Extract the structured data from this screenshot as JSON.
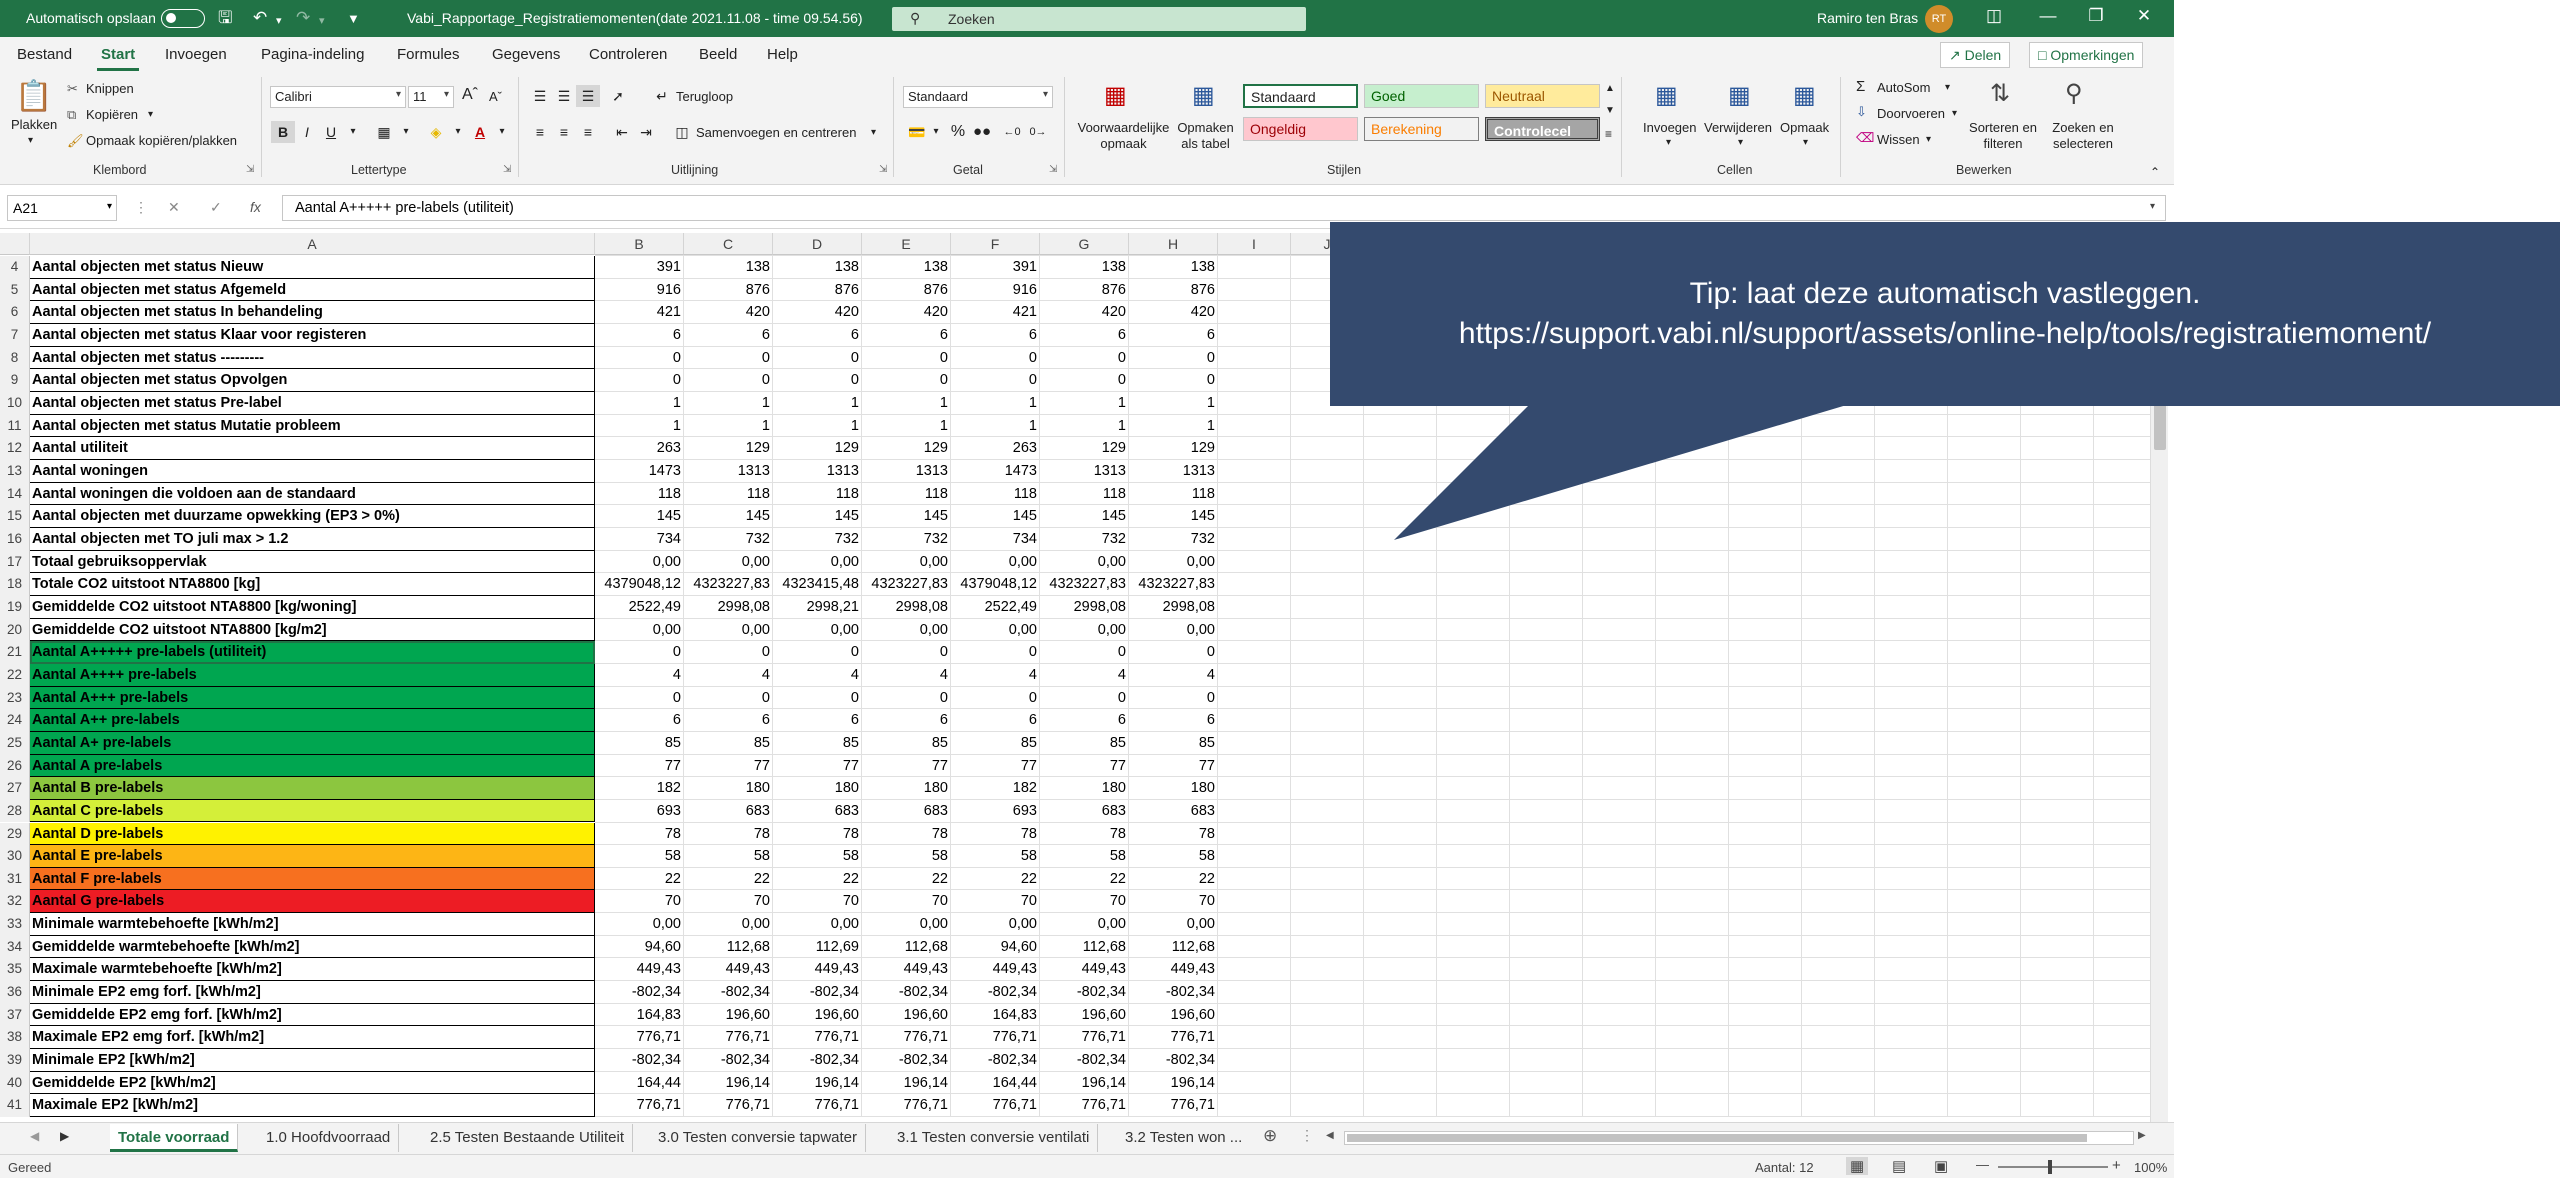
{
  "titlebar": {
    "autosave_label": "Automatisch opslaan",
    "file_title": "Vabi_Rapportage_Registratiemomenten(date 2021.11.08 - time 09.54.56)",
    "search_placeholder": "Zoeken",
    "user_name": "Ramiro ten Bras",
    "user_initials": "RT"
  },
  "menu": {
    "items": [
      "Bestand",
      "Start",
      "Invoegen",
      "Pagina-indeling",
      "Formules",
      "Gegevens",
      "Controleren",
      "Beeld",
      "Help"
    ],
    "active": "Start",
    "share_label": "Delen",
    "comments_label": "Opmerkingen"
  },
  "ribbon": {
    "klembord": {
      "plakken": "Plakken",
      "knippen": "Knippen",
      "kopieren": "Kopiëren",
      "opmaak_kopieren": "Opmaak kopiëren/plakken",
      "group": "Klembord"
    },
    "lettertype": {
      "font": "Calibri",
      "size": "11",
      "group": "Lettertype"
    },
    "uitlijning": {
      "terugloop": "Terugloop",
      "samenvoegen": "Samenvoegen en centreren",
      "group": "Uitlijning"
    },
    "getal": {
      "format": "Standaard",
      "group": "Getal"
    },
    "stijlen": {
      "voorwaardelijk": "Voorwaardelijke opmaak",
      "opmaken_tabel": "Opmaken als tabel",
      "styles": [
        "Standaard",
        "Goed",
        "Neutraal",
        "Ongeldig",
        "Berekening",
        "Controlecel"
      ],
      "group": "Stijlen"
    },
    "cellen": {
      "invoegen": "Invoegen",
      "verwijderen": "Verwijderen",
      "opmaak": "Opmaak",
      "group": "Cellen"
    },
    "bewerken": {
      "autosom": "AutoSom",
      "doorvoeren": "Doorvoeren",
      "wissen": "Wissen",
      "sorteren": "Sorteren en filteren",
      "zoeken": "Zoeken en selecteren",
      "group": "Bewerken"
    }
  },
  "formula_bar": {
    "name_box": "A21",
    "formula": "Aantal A+++++ pre-labels (utiliteit)"
  },
  "grid": {
    "columns": [
      "A",
      "B",
      "C",
      "D",
      "E",
      "F",
      "G",
      "H",
      "I",
      "J"
    ],
    "rows": [
      {
        "n": "4",
        "label": "Aantal objecten met status Nieuw",
        "v": [
          "391",
          "138",
          "138",
          "138",
          "391",
          "138",
          "138"
        ],
        "fill": ""
      },
      {
        "n": "5",
        "label": "Aantal objecten met status Afgemeld",
        "v": [
          "916",
          "876",
          "876",
          "876",
          "916",
          "876",
          "876"
        ],
        "fill": ""
      },
      {
        "n": "6",
        "label": "Aantal objecten met status In behandeling",
        "v": [
          "421",
          "420",
          "420",
          "420",
          "421",
          "420",
          "420"
        ],
        "fill": ""
      },
      {
        "n": "7",
        "label": "Aantal objecten met status Klaar voor registeren",
        "v": [
          "6",
          "6",
          "6",
          "6",
          "6",
          "6",
          "6"
        ],
        "fill": ""
      },
      {
        "n": "8",
        "label": "Aantal objecten met status ---------",
        "v": [
          "0",
          "0",
          "0",
          "0",
          "0",
          "0",
          "0"
        ],
        "fill": ""
      },
      {
        "n": "9",
        "label": "Aantal objecten met status Opvolgen",
        "v": [
          "0",
          "0",
          "0",
          "0",
          "0",
          "0",
          "0"
        ],
        "fill": ""
      },
      {
        "n": "10",
        "label": "Aantal objecten met status Pre-label",
        "v": [
          "1",
          "1",
          "1",
          "1",
          "1",
          "1",
          "1"
        ],
        "fill": ""
      },
      {
        "n": "11",
        "label": "Aantal objecten met status Mutatie probleem",
        "v": [
          "1",
          "1",
          "1",
          "1",
          "1",
          "1",
          "1"
        ],
        "fill": ""
      },
      {
        "n": "12",
        "label": "Aantal utiliteit",
        "v": [
          "263",
          "129",
          "129",
          "129",
          "263",
          "129",
          "129"
        ],
        "fill": ""
      },
      {
        "n": "13",
        "label": "Aantal woningen",
        "v": [
          "1473",
          "1313",
          "1313",
          "1313",
          "1473",
          "1313",
          "1313"
        ],
        "fill": ""
      },
      {
        "n": "14",
        "label": "Aantal woningen die voldoen aan de standaard",
        "v": [
          "118",
          "118",
          "118",
          "118",
          "118",
          "118",
          "118"
        ],
        "fill": ""
      },
      {
        "n": "15",
        "label": "Aantal objecten met duurzame opwekking (EP3 > 0%)",
        "v": [
          "145",
          "145",
          "145",
          "145",
          "145",
          "145",
          "145"
        ],
        "fill": ""
      },
      {
        "n": "16",
        "label": "Aantal objecten met TO juli max > 1.2",
        "v": [
          "734",
          "732",
          "732",
          "732",
          "734",
          "732",
          "732"
        ],
        "fill": ""
      },
      {
        "n": "17",
        "label": "Totaal gebruiksoppervlak",
        "v": [
          "0,00",
          "0,00",
          "0,00",
          "0,00",
          "0,00",
          "0,00",
          "0,00"
        ],
        "fill": ""
      },
      {
        "n": "18",
        "label": "Totale CO2 uitstoot NTA8800 [kg]",
        "v": [
          "4379048,12",
          "4323227,83",
          "4323415,48",
          "4323227,83",
          "4379048,12",
          "4323227,83",
          "4323227,83"
        ],
        "fill": ""
      },
      {
        "n": "19",
        "label": "Gemiddelde CO2 uitstoot NTA8800 [kg/woning]",
        "v": [
          "2522,49",
          "2998,08",
          "2998,21",
          "2998,08",
          "2522,49",
          "2998,08",
          "2998,08"
        ],
        "fill": ""
      },
      {
        "n": "20",
        "label": "Gemiddelde CO2 uitstoot NTA8800 [kg/m2]",
        "v": [
          "0,00",
          "0,00",
          "0,00",
          "0,00",
          "0,00",
          "0,00",
          "0,00"
        ],
        "fill": ""
      },
      {
        "n": "21",
        "label": "Aantal A+++++ pre-labels (utiliteit)",
        "v": [
          "0",
          "0",
          "0",
          "0",
          "0",
          "0",
          "0"
        ],
        "fill": "#00a650"
      },
      {
        "n": "22",
        "label": "Aantal A++++ pre-labels",
        "v": [
          "4",
          "4",
          "4",
          "4",
          "4",
          "4",
          "4"
        ],
        "fill": "#00a650"
      },
      {
        "n": "23",
        "label": "Aantal A+++ pre-labels",
        "v": [
          "0",
          "0",
          "0",
          "0",
          "0",
          "0",
          "0"
        ],
        "fill": "#00a650"
      },
      {
        "n": "24",
        "label": "Aantal A++ pre-labels",
        "v": [
          "6",
          "6",
          "6",
          "6",
          "6",
          "6",
          "6"
        ],
        "fill": "#00a650"
      },
      {
        "n": "25",
        "label": "Aantal A+ pre-labels",
        "v": [
          "85",
          "85",
          "85",
          "85",
          "85",
          "85",
          "85"
        ],
        "fill": "#00a650"
      },
      {
        "n": "26",
        "label": "Aantal A pre-labels",
        "v": [
          "77",
          "77",
          "77",
          "77",
          "77",
          "77",
          "77"
        ],
        "fill": "#00a650"
      },
      {
        "n": "27",
        "label": "Aantal B pre-labels",
        "v": [
          "182",
          "180",
          "180",
          "180",
          "182",
          "180",
          "180"
        ],
        "fill": "#8cc63f"
      },
      {
        "n": "28",
        "label": "Aantal C pre-labels",
        "v": [
          "693",
          "683",
          "683",
          "683",
          "693",
          "683",
          "683"
        ],
        "fill": "#d4ef39"
      },
      {
        "n": "29",
        "label": "Aantal D pre-labels",
        "v": [
          "78",
          "78",
          "78",
          "78",
          "78",
          "78",
          "78"
        ],
        "fill": "#fff200"
      },
      {
        "n": "30",
        "label": "Aantal E pre-labels",
        "v": [
          "58",
          "58",
          "58",
          "58",
          "58",
          "58",
          "58"
        ],
        "fill": "#fdb515"
      },
      {
        "n": "31",
        "label": "Aantal F pre-labels",
        "v": [
          "22",
          "22",
          "22",
          "22",
          "22",
          "22",
          "22"
        ],
        "fill": "#f7701f"
      },
      {
        "n": "32",
        "label": "Aantal G pre-labels",
        "v": [
          "70",
          "70",
          "70",
          "70",
          "70",
          "70",
          "70"
        ],
        "fill": "#ed1c24"
      },
      {
        "n": "33",
        "label": "Minimale warmtebehoefte [kWh/m2]",
        "v": [
          "0,00",
          "0,00",
          "0,00",
          "0,00",
          "0,00",
          "0,00",
          "0,00"
        ],
        "fill": ""
      },
      {
        "n": "34",
        "label": "Gemiddelde warmtebehoefte [kWh/m2]",
        "v": [
          "94,60",
          "112,68",
          "112,69",
          "112,68",
          "94,60",
          "112,68",
          "112,68"
        ],
        "fill": ""
      },
      {
        "n": "35",
        "label": "Maximale warmtebehoefte [kWh/m2]",
        "v": [
          "449,43",
          "449,43",
          "449,43",
          "449,43",
          "449,43",
          "449,43",
          "449,43"
        ],
        "fill": ""
      },
      {
        "n": "36",
        "label": "Minimale EP2 emg forf. [kWh/m2]",
        "v": [
          "-802,34",
          "-802,34",
          "-802,34",
          "-802,34",
          "-802,34",
          "-802,34",
          "-802,34"
        ],
        "fill": ""
      },
      {
        "n": "37",
        "label": "Gemiddelde EP2 emg forf. [kWh/m2]",
        "v": [
          "164,83",
          "196,60",
          "196,60",
          "196,60",
          "164,83",
          "196,60",
          "196,60"
        ],
        "fill": ""
      },
      {
        "n": "38",
        "label": "Maximale EP2 emg forf. [kWh/m2]",
        "v": [
          "776,71",
          "776,71",
          "776,71",
          "776,71",
          "776,71",
          "776,71",
          "776,71"
        ],
        "fill": ""
      },
      {
        "n": "39",
        "label": "Minimale EP2 [kWh/m2]",
        "v": [
          "-802,34",
          "-802,34",
          "-802,34",
          "-802,34",
          "-802,34",
          "-802,34",
          "-802,34"
        ],
        "fill": ""
      },
      {
        "n": "40",
        "label": "Gemiddelde EP2 [kWh/m2]",
        "v": [
          "164,44",
          "196,14",
          "196,14",
          "196,14",
          "164,44",
          "196,14",
          "196,14"
        ],
        "fill": ""
      },
      {
        "n": "41",
        "label": "Maximale EP2 [kWh/m2]",
        "v": [
          "776,71",
          "776,71",
          "776,71",
          "776,71",
          "776,71",
          "776,71",
          "776,71"
        ],
        "fill": ""
      }
    ]
  },
  "callout": {
    "line1": "Tip: laat deze automatisch vastleggen.",
    "line2": "https://support.vabi.nl/support/assets/online-help/tools/registratiemoment/"
  },
  "sheet_tabs": [
    "Totale voorraad",
    "1.0 Hoofdvoorraad",
    "2.5 Testen Bestaande Utiliteit",
    "3.0 Testen conversie tapwater",
    "3.1 Testen conversie ventilati",
    "3.2 Testen won ..."
  ],
  "status": {
    "left": "Gereed",
    "count": "Aantal: 12",
    "zoom": "100%"
  }
}
